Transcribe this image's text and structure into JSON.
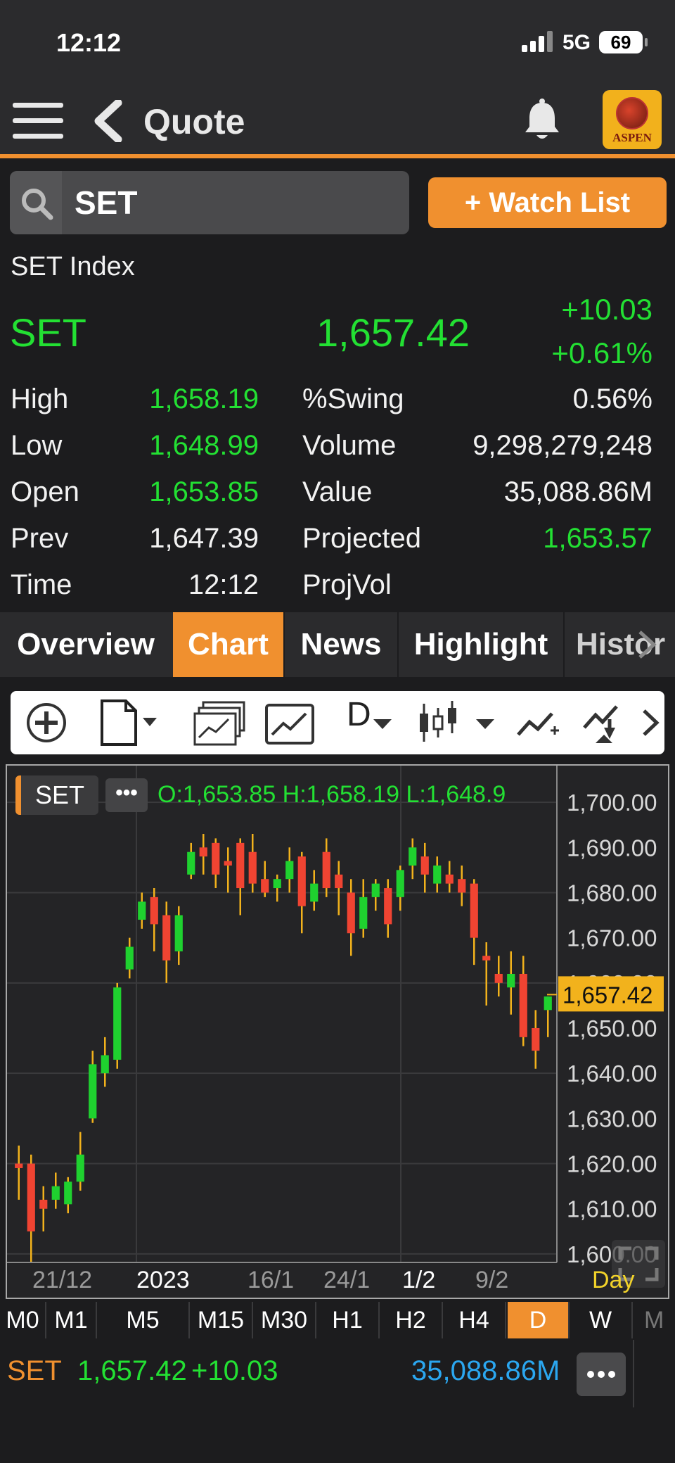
{
  "status_bar": {
    "time": "12:12",
    "network": "5G",
    "battery": "69"
  },
  "header": {
    "title": "Quote",
    "logo_text": "ASPEN"
  },
  "search": {
    "value": "SET",
    "placeholder": ""
  },
  "watchlist_button": "+ Watch List",
  "quote": {
    "name": "SET Index",
    "symbol": "SET",
    "last": "1,657.42",
    "change": "+10.03",
    "change_pct": "+0.61%",
    "stats": {
      "high_label": "High",
      "high": "1,658.19",
      "low_label": "Low",
      "low": "1,648.99",
      "open_label": "Open",
      "open": "1,653.85",
      "prev_label": "Prev",
      "prev": "1,647.39",
      "time_label": "Time",
      "time": "12:12",
      "swing_label": "%Swing",
      "swing": "0.56%",
      "volume_label": "Volume",
      "volume": "9,298,279,248",
      "value_label": "Value",
      "value": "35,088.86M",
      "projected_label": "Projected",
      "projected": "1,653.57",
      "projvol_label": "ProjVol",
      "projvol": ""
    }
  },
  "tabs": [
    {
      "label": "Overview"
    },
    {
      "label": "Chart",
      "active": true
    },
    {
      "label": "News"
    },
    {
      "label": "Highlight"
    },
    {
      "label": "Histor"
    }
  ],
  "chart_toolbar": {
    "timeframe": "D"
  },
  "chart": {
    "symbol": "SET",
    "more_label": "•••",
    "ohl_text": "O:1,653.85  H:1,658.19  L:1,648.9",
    "period_label": "Day",
    "last_price_label": "1,657.42",
    "colors": {
      "up": "#1fd12f",
      "down": "#f04432",
      "wick": "#f2b21c",
      "last_tag": "#f2b21c"
    }
  },
  "chart_data": {
    "type": "candlestick",
    "ylim": [
      1595,
      1705
    ],
    "y_ticks": [
      "1,700.00",
      "1,690.00",
      "1,680.00",
      "1,670.00",
      "1,660.00",
      "1,650.00",
      "1,640.00",
      "1,630.00",
      "1,620.00",
      "1,610.00",
      "1,600.00"
    ],
    "x_labels": [
      "21/12",
      "2023",
      "16/1",
      "24/1",
      "1/2",
      "9/2"
    ],
    "last_price": 1657.42,
    "candles": [
      {
        "o": 1620,
        "h": 1624,
        "l": 1612,
        "c": 1619
      },
      {
        "o": 1620,
        "h": 1622,
        "l": 1598,
        "c": 1605
      },
      {
        "o": 1612,
        "h": 1615,
        "l": 1605,
        "c": 1610
      },
      {
        "o": 1612,
        "h": 1618,
        "l": 1610,
        "c": 1615
      },
      {
        "o": 1611,
        "h": 1617,
        "l": 1609,
        "c": 1616
      },
      {
        "o": 1616,
        "h": 1627,
        "l": 1614,
        "c": 1622
      },
      {
        "o": 1630,
        "h": 1645,
        "l": 1629,
        "c": 1642
      },
      {
        "o": 1640,
        "h": 1648,
        "l": 1637,
        "c": 1644
      },
      {
        "o": 1643,
        "h": 1660,
        "l": 1641,
        "c": 1659
      },
      {
        "o": 1663,
        "h": 1670,
        "l": 1661,
        "c": 1668
      },
      {
        "o": 1674,
        "h": 1680,
        "l": 1672,
        "c": 1678
      },
      {
        "o": 1679,
        "h": 1681,
        "l": 1667,
        "c": 1673
      },
      {
        "o": 1675,
        "h": 1678,
        "l": 1660,
        "c": 1665
      },
      {
        "o": 1667,
        "h": 1677,
        "l": 1664,
        "c": 1675
      },
      {
        "o": 1684,
        "h": 1691,
        "l": 1683,
        "c": 1689
      },
      {
        "o": 1690,
        "h": 1693,
        "l": 1684,
        "c": 1688
      },
      {
        "o": 1691,
        "h": 1692,
        "l": 1681,
        "c": 1684
      },
      {
        "o": 1687,
        "h": 1690,
        "l": 1680,
        "c": 1686
      },
      {
        "o": 1691,
        "h": 1692,
        "l": 1675,
        "c": 1681
      },
      {
        "o": 1689,
        "h": 1693,
        "l": 1680,
        "c": 1682
      },
      {
        "o": 1683,
        "h": 1687,
        "l": 1679,
        "c": 1680
      },
      {
        "o": 1681,
        "h": 1684,
        "l": 1678,
        "c": 1683
      },
      {
        "o": 1683,
        "h": 1690,
        "l": 1680,
        "c": 1687
      },
      {
        "o": 1688,
        "h": 1689,
        "l": 1671,
        "c": 1677
      },
      {
        "o": 1678,
        "h": 1685,
        "l": 1676,
        "c": 1682
      },
      {
        "o": 1689,
        "h": 1692,
        "l": 1679,
        "c": 1681
      },
      {
        "o": 1684,
        "h": 1687,
        "l": 1675,
        "c": 1681
      },
      {
        "o": 1680,
        "h": 1683,
        "l": 1666,
        "c": 1671
      },
      {
        "o": 1672,
        "h": 1683,
        "l": 1670,
        "c": 1679
      },
      {
        "o": 1679,
        "h": 1683,
        "l": 1676,
        "c": 1682
      },
      {
        "o": 1681,
        "h": 1683,
        "l": 1670,
        "c": 1673
      },
      {
        "o": 1679,
        "h": 1686,
        "l": 1676,
        "c": 1685
      },
      {
        "o": 1686,
        "h": 1692,
        "l": 1683,
        "c": 1690
      },
      {
        "o": 1688,
        "h": 1691,
        "l": 1680,
        "c": 1684
      },
      {
        "o": 1682,
        "h": 1688,
        "l": 1680,
        "c": 1686
      },
      {
        "o": 1684,
        "h": 1687,
        "l": 1680,
        "c": 1682
      },
      {
        "o": 1683,
        "h": 1686,
        "l": 1677,
        "c": 1680
      },
      {
        "o": 1682,
        "h": 1683,
        "l": 1664,
        "c": 1670
      },
      {
        "o": 1666,
        "h": 1669,
        "l": 1655,
        "c": 1665
      },
      {
        "o": 1662,
        "h": 1666,
        "l": 1657,
        "c": 1660
      },
      {
        "o": 1659,
        "h": 1667,
        "l": 1653,
        "c": 1662
      },
      {
        "o": 1662,
        "h": 1666,
        "l": 1646,
        "c": 1648
      },
      {
        "o": 1650,
        "h": 1654,
        "l": 1641,
        "c": 1645
      },
      {
        "o": 1654,
        "h": 1657,
        "l": 1648,
        "c": 1657
      }
    ]
  },
  "periods": [
    {
      "label": "M0"
    },
    {
      "label": "M1"
    },
    {
      "label": "M5"
    },
    {
      "label": "M15"
    },
    {
      "label": "M30"
    },
    {
      "label": "H1"
    },
    {
      "label": "H2"
    },
    {
      "label": "H4"
    },
    {
      "label": "D",
      "active": true
    },
    {
      "label": "W"
    },
    {
      "label": "M"
    }
  ],
  "bottom_bar": {
    "symbol": "SET",
    "last": "1,657.42",
    "change": "+10.03",
    "value": "35,088.86M"
  }
}
